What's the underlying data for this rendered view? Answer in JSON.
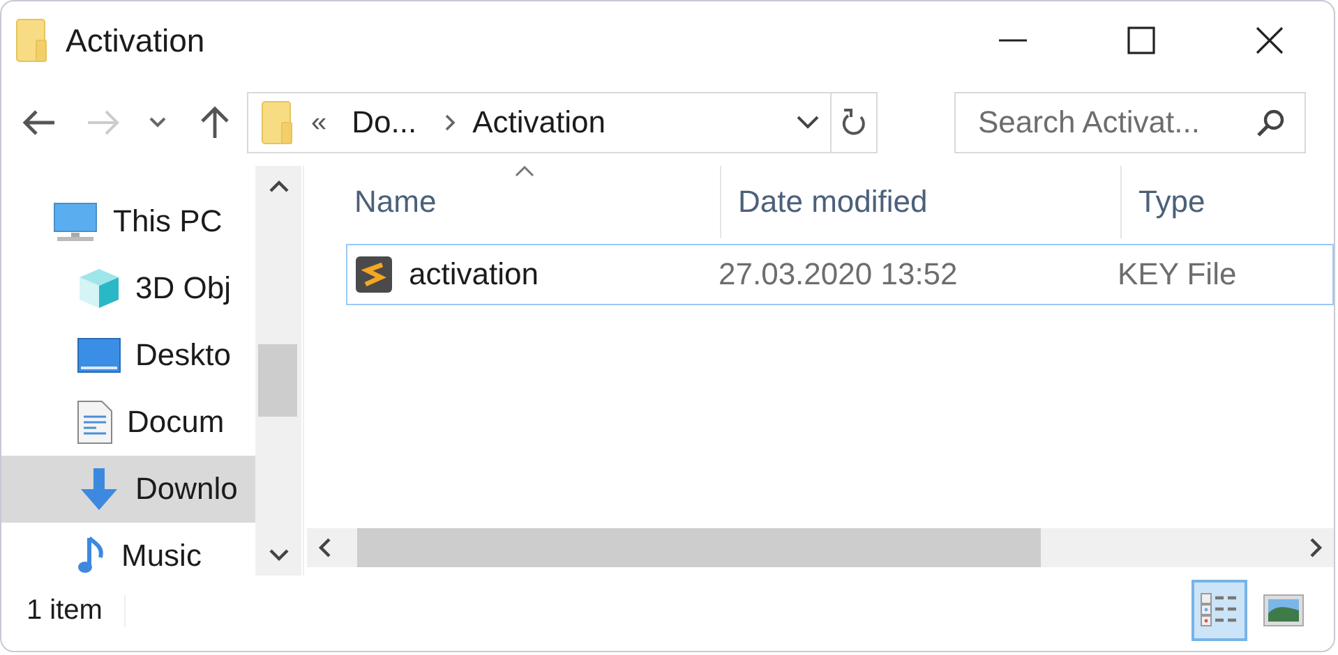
{
  "window": {
    "title": "Activation"
  },
  "address": {
    "overflow": "«",
    "crumbs": [
      "Do...",
      "Activation"
    ]
  },
  "search": {
    "placeholder": "Search Activat..."
  },
  "nav_items": [
    {
      "label": "This PC",
      "kind": "pc",
      "selected": false
    },
    {
      "label": "3D Obj",
      "kind": "cube",
      "selected": false
    },
    {
      "label": "Deskto",
      "kind": "desktop",
      "selected": false
    },
    {
      "label": "Docum",
      "kind": "document",
      "selected": false
    },
    {
      "label": "Downlo",
      "kind": "download",
      "selected": true
    },
    {
      "label": "Music",
      "kind": "music",
      "selected": false
    }
  ],
  "table": {
    "columns": [
      "Name",
      "Date modified",
      "Type"
    ],
    "rows": [
      {
        "name": "activation",
        "date": "27.03.2020 13:52",
        "type": "KEY File",
        "selected": true
      }
    ]
  },
  "status_bar": {
    "count": "1 item",
    "views": [
      {
        "kind": "details",
        "selected": true
      },
      {
        "kind": "large",
        "selected": false
      }
    ]
  }
}
